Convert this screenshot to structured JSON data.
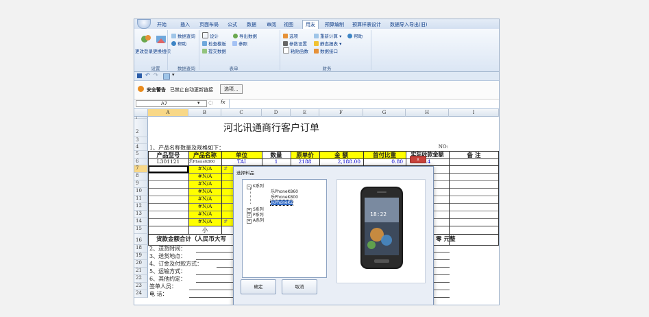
{
  "ribbon": {
    "tabs": [
      "开始",
      "插入",
      "页面布局",
      "公式",
      "数据",
      "审阅",
      "视图",
      "用友",
      "预算编制",
      "预算样表设计",
      "数据导入导出(旧)"
    ],
    "active_tab": "用友",
    "groups": {
      "settings": {
        "label": "设置",
        "buttons": [
          "更改登录",
          "更换组织"
        ]
      },
      "dataquery": {
        "label": "数据查询",
        "buttons": [
          "数据查询",
          "帮助"
        ]
      },
      "form": {
        "label": "表单",
        "buttons": [
          "设计",
          "检查模板",
          "提交数据",
          "导出数据",
          "参照"
        ]
      },
      "finance": {
        "label": "财务",
        "buttons": [
          "选项",
          "参数设置",
          "粘贴函数",
          "重新计算",
          "帮助",
          "静态报表",
          "数据接口"
        ]
      }
    }
  },
  "security": {
    "label": "安全警告",
    "message": "已禁止自动更新链接",
    "options_button": "选项..."
  },
  "formula_bar": {
    "name_box": "A7",
    "fx": "fx"
  },
  "columns": [
    "A",
    "B",
    "C",
    "D",
    "E",
    "F",
    "G",
    "H",
    "I"
  ],
  "rows": [
    "1",
    "2",
    "3",
    "4",
    "5",
    "6",
    "7",
    "8",
    "9",
    "10",
    "11",
    "12",
    "13",
    "14",
    "15",
    "16",
    "18",
    "19",
    "20",
    "21",
    "22",
    "23",
    "24"
  ],
  "sheet": {
    "title": "河北讯通商行客户订单",
    "section1": "1、产品名称数量及规格如下：",
    "no_label": "NO:",
    "headers": [
      "产品型号",
      "产品名称",
      "单位",
      "数量",
      "原单价",
      "金  额",
      "首付比重",
      "实际收款金额",
      "备  注"
    ],
    "row6": [
      "L301121",
      "乐PhoneK860",
      "TAI",
      "1",
      "2188",
      "2,188.00",
      "0.80",
      "1750.4",
      ""
    ],
    "na": "#N/A",
    "small_label": "小",
    "total_label": "货款金额合计（人民币大写",
    "total_tail": "零 元整",
    "notes": [
      "2、送货时间：",
      "3、送货地点：",
      "4、订金及付款方式：",
      "5、运输方式：",
      "6、其他约定：",
      "签单人员：",
      "电    话："
    ]
  },
  "dialog": {
    "title": "选择料品",
    "close": "x",
    "tree": {
      "root": "K系列",
      "children": [
        "乐PhoneK860",
        "乐PhoneK800",
        "乐PhoneK2"
      ],
      "selected": "乐PhoneK2",
      "siblings": [
        "S系列",
        "P系列",
        "A系列"
      ]
    },
    "phone_time": "18:22",
    "ok": "确定",
    "cancel": "取消"
  }
}
